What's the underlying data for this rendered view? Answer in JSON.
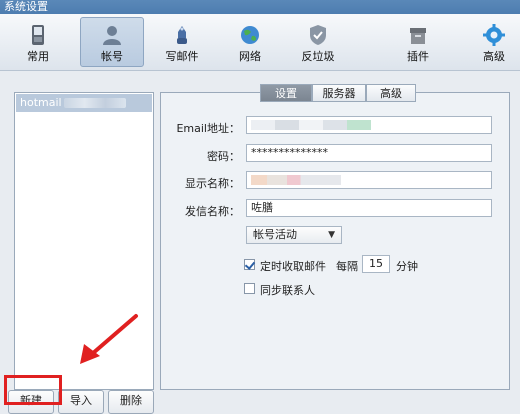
{
  "window": {
    "title": "系统设置"
  },
  "toolbar": {
    "items": [
      {
        "label": "常用",
        "icon": "phone-icon"
      },
      {
        "label": "帐号",
        "icon": "user-icon"
      },
      {
        "label": "写邮件",
        "icon": "compose-icon"
      },
      {
        "label": "网络",
        "icon": "globe-icon"
      },
      {
        "label": "反垃圾",
        "icon": "shield-icon"
      },
      {
        "label": "插件",
        "icon": "box-icon"
      },
      {
        "label": "高级",
        "icon": "gear-icon"
      }
    ],
    "active": "帐号"
  },
  "accounts": {
    "items": [
      {
        "label": "hotmail"
      }
    ]
  },
  "bottom_buttons": {
    "new": "新建",
    "import": "导入",
    "delete": "删除"
  },
  "tabs": [
    {
      "label": "设置"
    },
    {
      "label": "服务器"
    },
    {
      "label": "高级"
    }
  ],
  "form": {
    "email_label": "Email地址：",
    "password_label": "密码：",
    "password_value": "**************",
    "display_name_label": "显示名称：",
    "sender_name_label": "发信名称：",
    "sender_name_value": "咗膳",
    "account_status": "帐号活动",
    "auto_receive_label": "定时收取邮件",
    "interval_prefix": "每隔",
    "interval_value": "15",
    "interval_unit": "分钟",
    "sync_contacts_label": "同步联系人"
  },
  "colors": {
    "highlight": "#e02020",
    "toolbar_active": "#b9cbe0"
  }
}
